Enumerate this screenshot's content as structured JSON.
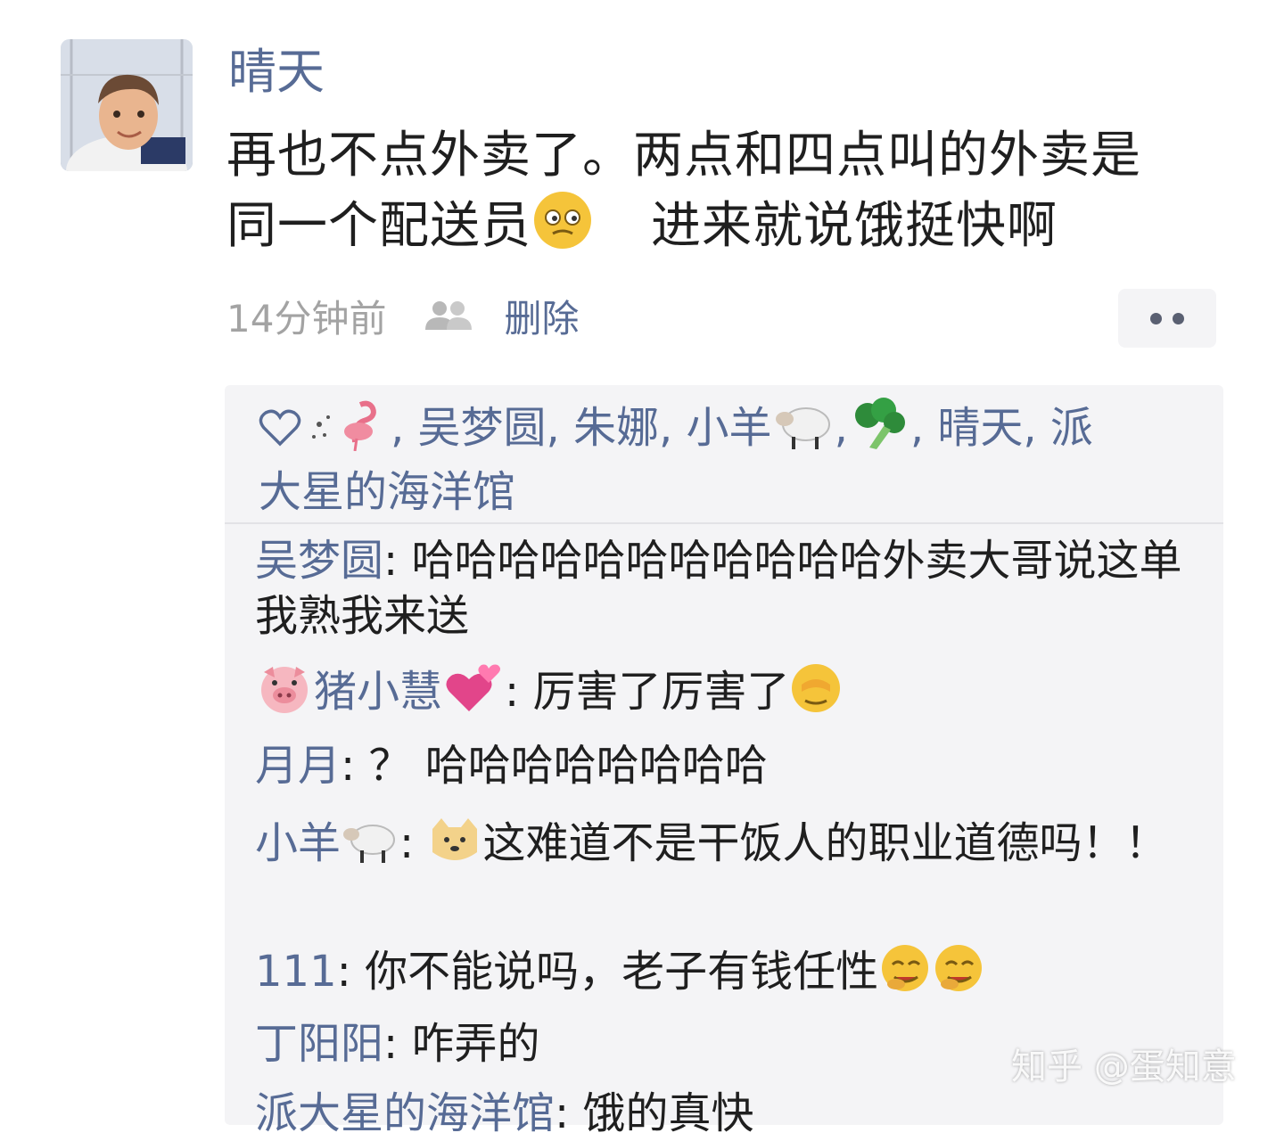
{
  "post": {
    "poster_name": "晴天",
    "text_line1": "再也不点外卖了。两点和四点叫的外卖是",
    "text_line2a": "同一个配送员",
    "text_line2b": "进来就说饿挺快啊",
    "timestamp": "14分钟前",
    "delete_label": "删除"
  },
  "likes": {
    "names_a": ", 吴梦圆, 朱娜, 小羊",
    "names_b": ",",
    "names_c": ", 晴天, 派",
    "names_d": "大星的海洋馆"
  },
  "comments": [
    {
      "name": "吴梦圆",
      "sep": ": ",
      "text": "哈哈哈哈哈哈哈哈哈哈哈外卖大哥说这单我熟我来送"
    },
    {
      "name": "猪小慧",
      "sep": ": ",
      "text": "厉害了厉害了"
    },
    {
      "name": "月月",
      "sep": ": ",
      "text": "？ 哈哈哈哈哈哈哈哈"
    },
    {
      "name": "小羊",
      "sep": ": ",
      "text": "这难道不是干饭人的职业道德吗！！"
    },
    {
      "name": "111",
      "sep": ": ",
      "text": "你不能说吗，老子有钱任性"
    },
    {
      "name": "丁阳阳",
      "sep": ": ",
      "text": "咋弄的"
    },
    {
      "name": "派大星的海洋馆",
      "sep": ": ",
      "text": "饿的真快"
    }
  ],
  "watermark": "知乎 @蛋知意",
  "colors": {
    "name_blue": "#576b95",
    "panel_bg": "#f4f4f6",
    "meta_gray": "#a3a3a3"
  },
  "icons": [
    "heart-outline-icon",
    "flamingo-emoji-icon",
    "sheep-emoji-icon",
    "broccoli-emoji-icon",
    "pig-face-emoji-icon",
    "heart-emoji-icon",
    "facepalm-emoji-icon",
    "doge-emoji-icon",
    "laughing-emoji-icon",
    "friends-icon",
    "more-icon"
  ]
}
